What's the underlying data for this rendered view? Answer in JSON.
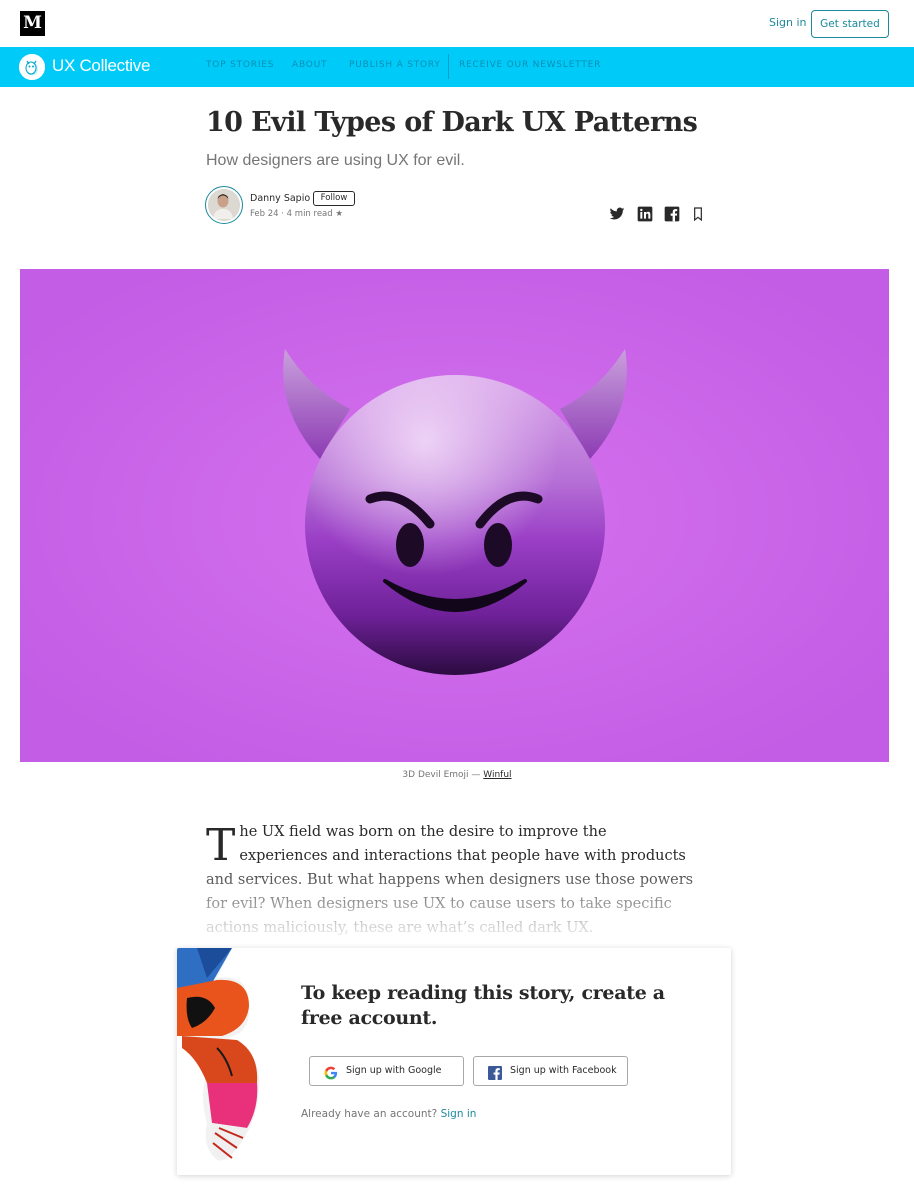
{
  "topbar": {
    "logo": "M",
    "sign_in": "Sign in",
    "get_started": "Get started"
  },
  "publication": {
    "name": "UX Collective",
    "nav": [
      "TOP STORIES",
      "ABOUT",
      "PUBLISH A STORY",
      "RECEIVE OUR NEWSLETTER"
    ],
    "color": "#00cbf8"
  },
  "article": {
    "title": "10 Evil Types of Dark UX Patterns",
    "subtitle": "How designers are using UX for evil.",
    "author": "Danny Sapio",
    "follow": "Follow",
    "meta": "Feb 24 · 4 min read ★",
    "share_icons": [
      "twitter-icon",
      "linkedin-icon",
      "facebook-icon",
      "bookmark-icon"
    ],
    "hero_caption_prefix": "3D Devil Emoji — ",
    "hero_caption_link": "Winful",
    "dropcap": "T",
    "intro": "he UX field was born on the desire to improve the experiences and interactions that people have with products and services. But what happens when designers use those powers for evil? When designers use UX to cause users to take specific actions maliciously, these are what’s called dark UX."
  },
  "paywall": {
    "title": "To keep reading this story, create a free account.",
    "google_button": "Sign up with Google",
    "facebook_button": "Sign up with Facebook",
    "already_text": "Already have an account? ",
    "sign_in_link": "Sign in"
  },
  "colors": {
    "accent": "#1c8a9a",
    "hero_background": "#c862e8"
  }
}
